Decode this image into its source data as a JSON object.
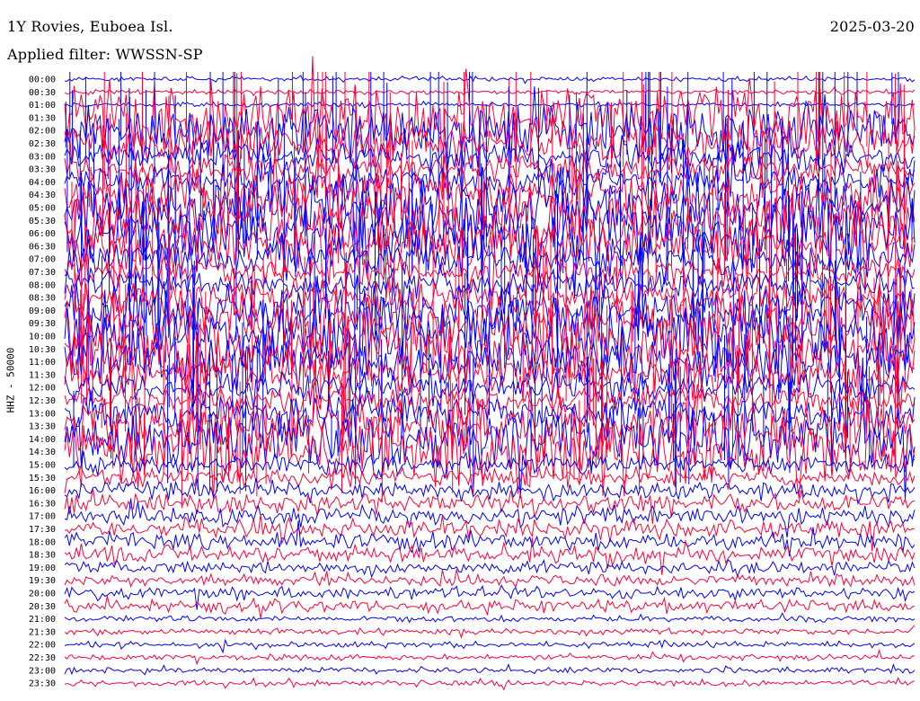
{
  "header": {
    "station": "1Y Rovies, Euboea Isl.",
    "date": "2025-03-20",
    "filter": "Applied filter: WWSSN-SP"
  },
  "axis": {
    "ylabel": "HHZ - 50000"
  },
  "colors": {
    "trace_a": "#0000ff",
    "trace_b": "#ff0033",
    "background": "#ffffff",
    "text": "#000000"
  },
  "chart_data": {
    "type": "line",
    "title": "1Y Rovies, Euboea Isl.",
    "ylabel": "HHZ - 50000",
    "categories": [
      "00:00",
      "00:30",
      "01:00",
      "01:30",
      "02:00",
      "02:30",
      "03:00",
      "03:30",
      "04:00",
      "04:30",
      "05:00",
      "05:30",
      "06:00",
      "06:30",
      "07:00",
      "07:30",
      "08:00",
      "08:30",
      "09:00",
      "09:30",
      "10:00",
      "10:30",
      "11:00",
      "11:30",
      "12:00",
      "12:30",
      "13:00",
      "13:30",
      "14:00",
      "14:30",
      "15:00",
      "15:30",
      "16:00",
      "16:30",
      "17:00",
      "17:30",
      "18:00",
      "18:30",
      "19:00",
      "19:30",
      "20:00",
      "20:30",
      "21:00",
      "21:30",
      "22:00",
      "22:30",
      "23:00",
      "23:30"
    ],
    "grid": false,
    "legend": "none"
  }
}
